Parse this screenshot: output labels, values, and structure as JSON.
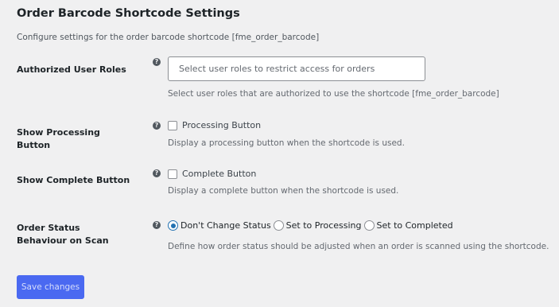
{
  "page": {
    "title": "Order Barcode Shortcode Settings",
    "description": "Configure settings for the order barcode shortcode [fme_order_barcode]"
  },
  "help_icon_glyph": "?",
  "authorized_roles": {
    "label": "Authorized User Roles",
    "placeholder": "Select user roles to restrict access for orders",
    "value": "",
    "description": "Select user roles that are authorized to use the shortcode [fme_order_barcode]"
  },
  "processing": {
    "label": "Show Processing Button",
    "checkbox_label": "Processing Button",
    "checked": false,
    "description": "Display a processing button when the shortcode is used."
  },
  "complete": {
    "label": "Show Complete Button",
    "checkbox_label": "Complete Button",
    "checked": false,
    "description": "Display a complete button when the shortcode is used."
  },
  "status_behaviour": {
    "label": "Order Status Behaviour on Scan",
    "options": [
      {
        "label": "Don't Change Status",
        "checked": true
      },
      {
        "label": "Set to Processing",
        "checked": false
      },
      {
        "label": "Set to Completed",
        "checked": false
      }
    ],
    "description": "Define how order status should be adjusted when an order is scanned using the shortcode."
  },
  "save_label": "Save changes",
  "colors": {
    "background": "#f0f0f1",
    "accent": "#2271b1",
    "save_button": "#4a69f1"
  },
  "icons": {
    "help": "help-icon"
  }
}
